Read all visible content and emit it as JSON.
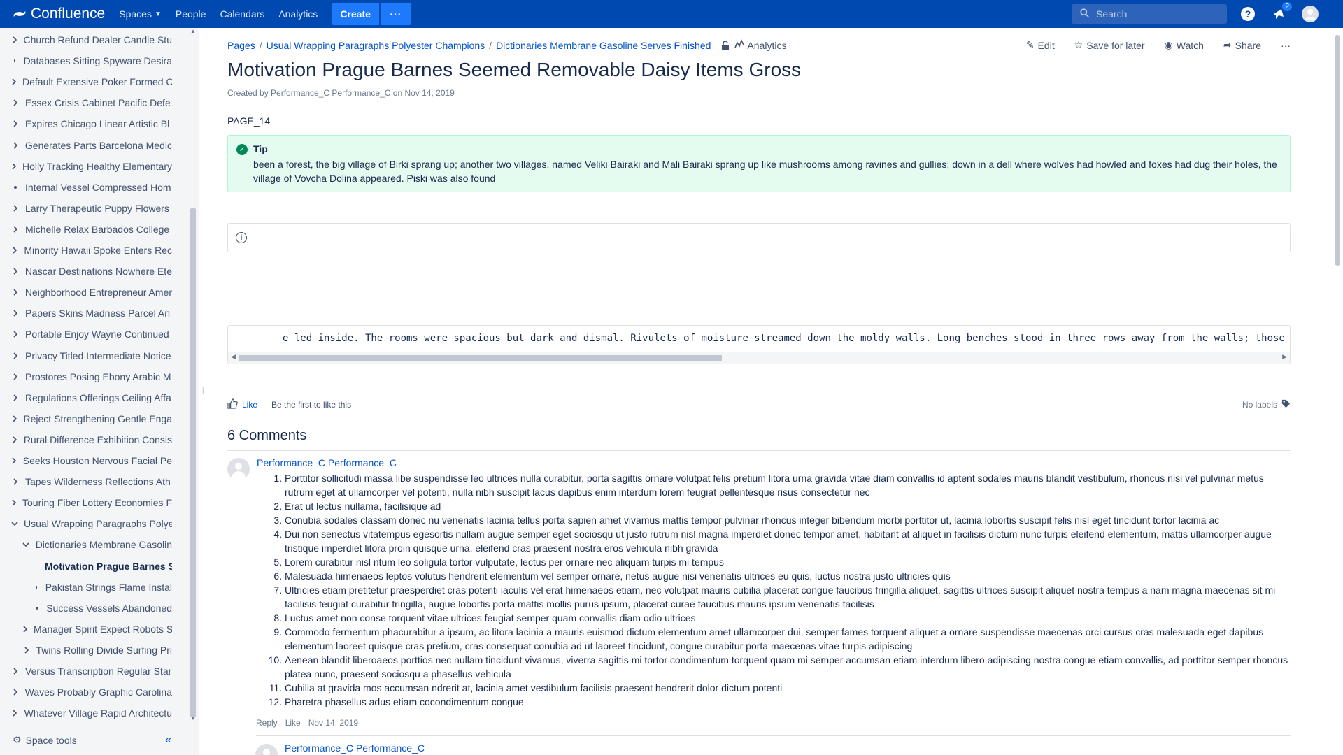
{
  "topnav": {
    "logo_text": "Confluence",
    "spaces": "Spaces",
    "people": "People",
    "calendars": "Calendars",
    "analytics": "Analytics",
    "create": "Create",
    "more": "···",
    "search_placeholder": "Search",
    "notifications_count": "2",
    "brand_color": "#0049b0"
  },
  "sidebar": {
    "items": [
      {
        "label": "Church Refund Dealer Candle Stu",
        "kind": "collapsed",
        "indent": 0
      },
      {
        "label": "Databases Sitting Spyware Desira",
        "kind": "leaf",
        "indent": 0
      },
      {
        "label": "Default Extensive Poker Formed C",
        "kind": "collapsed",
        "indent": 0
      },
      {
        "label": "Essex Crisis Cabinet Pacific Defe",
        "kind": "collapsed",
        "indent": 0
      },
      {
        "label": "Expires Chicago Linear Artistic Bl",
        "kind": "collapsed",
        "indent": 0
      },
      {
        "label": "Generates Parts Barcelona Medic",
        "kind": "collapsed",
        "indent": 0
      },
      {
        "label": "Holly Tracking Healthy Elementary",
        "kind": "collapsed",
        "indent": 0
      },
      {
        "label": "Internal Vessel Compressed Hom",
        "kind": "leaf",
        "indent": 0
      },
      {
        "label": "Larry Therapeutic Puppy Flowers",
        "kind": "collapsed",
        "indent": 0
      },
      {
        "label": "Michelle Relax Barbados College",
        "kind": "collapsed",
        "indent": 0
      },
      {
        "label": "Minority Hawaii Spoke Enters Rec",
        "kind": "collapsed",
        "indent": 0
      },
      {
        "label": "Nascar Destinations Nowhere Ete",
        "kind": "collapsed",
        "indent": 0
      },
      {
        "label": "Neighborhood Entrepreneur Amer",
        "kind": "collapsed",
        "indent": 0
      },
      {
        "label": "Papers Skins Madness Parcel An",
        "kind": "collapsed",
        "indent": 0
      },
      {
        "label": "Portable Enjoy Wayne Continued",
        "kind": "collapsed",
        "indent": 0
      },
      {
        "label": "Privacy Titled Intermediate Notice",
        "kind": "collapsed",
        "indent": 0
      },
      {
        "label": "Prostores Posing Ebony Arabic M",
        "kind": "collapsed",
        "indent": 0
      },
      {
        "label": "Regulations Offerings Ceiling Affa",
        "kind": "collapsed",
        "indent": 0
      },
      {
        "label": "Reject Strengthening Gentle Enga",
        "kind": "collapsed",
        "indent": 0
      },
      {
        "label": "Rural Difference Exhibition Consis",
        "kind": "collapsed",
        "indent": 0
      },
      {
        "label": "Seeks Houston Nervous Facial Pe",
        "kind": "collapsed",
        "indent": 0
      },
      {
        "label": "Tapes Wilderness Reflections Ath",
        "kind": "collapsed",
        "indent": 0
      },
      {
        "label": "Touring Fiber Lottery Economies F",
        "kind": "collapsed",
        "indent": 0
      },
      {
        "label": "Usual Wrapping Paragraphs Polye",
        "kind": "expanded",
        "indent": 0
      },
      {
        "label": "Dictionaries Membrane Gasolin",
        "kind": "expanded",
        "indent": 1
      },
      {
        "label": "Motivation Prague Barnes S",
        "kind": "leaf-current",
        "indent": 2
      },
      {
        "label": "Pakistan Strings Flame Instal",
        "kind": "leaf",
        "indent": 2
      },
      {
        "label": "Success Vessels Abandoned",
        "kind": "leaf",
        "indent": 2
      },
      {
        "label": "Manager Spirit Expect Robots S",
        "kind": "collapsed",
        "indent": 1
      },
      {
        "label": "Twins Rolling Divide Surfing Pri",
        "kind": "collapsed",
        "indent": 1
      },
      {
        "label": "Versus Transcription Regular Star",
        "kind": "collapsed",
        "indent": 0
      },
      {
        "label": "Waves Probably Graphic Carolina",
        "kind": "collapsed",
        "indent": 0
      },
      {
        "label": "Whatever Village Rapid Architectu",
        "kind": "collapsed",
        "indent": 0
      }
    ],
    "space_tools": "Space tools",
    "collapse_glyph": "«"
  },
  "breadcrumbs": {
    "items": [
      "Pages",
      "Usual Wrapping Paragraphs Polyester Champions",
      "Dictionaries Membrane Gasoline Serves Finished"
    ],
    "analytics": "Analytics"
  },
  "actions": {
    "edit": "Edit",
    "save_for_later": "Save for later",
    "watch": "Watch",
    "share": "Share",
    "more": "···"
  },
  "page": {
    "title": "Motivation Prague Barnes Seemed Removable Daisy Items Gross",
    "byline": "Created by Performance_C Performance_C on Nov 14, 2019",
    "page_id": "PAGE_14",
    "tip_title": "Tip",
    "tip_body": "been a forest, the big village of Birki sprang up; another two villages, named Veliki Bairaki and Mali Bairaki sprang up like mushrooms among ravines and gullies; down in a dell where wolves had howled and foxes had dug their holes, the village of Vovcha Dolina appeared. Piski was also found",
    "code_text": "e led inside. The rooms were spacious but dark and dismal. Rivulets of moisture streamed down the moldy walls. Long benches stood in three rows away from the walls; those w",
    "like": "Like",
    "like_text": "Be the first to like this",
    "labels": "No labels"
  },
  "comments": {
    "title": "6 Comments",
    "first": {
      "author": "Performance_C Performance_C",
      "items": [
        "Porttitor sollicitudi massa libe suspendisse leo ultrices nulla curabitur, porta sagittis ornare volutpat felis pretium litora urna gravida vitae diam convallis id aptent sodales mauris blandit vestibulum, rhoncus nisi vel pulvinar metus rutrum eget at ullamcorper vel potenti, nulla nibh suscipit lacus dapibus enim interdum lorem feugiat pellentesque risus consectetur nec",
        "Erat ut lectus nullama, facilisique ad",
        "Conubia sodales classam donec nu venenatis lacinia tellus porta sapien amet vivamus mattis tempor pulvinar rhoncus integer bibendum morbi porttitor ut, lacinia lobortis suscipit felis nisl eget tincidunt tortor lacinia ac",
        "Dui non senectus vitatempus egesortis nullam augue semper eget sociosqu ut justo rutrum nisl magna imperdiet donec tempor amet, habitant at aliquet in facilisis dictum nunc turpis eleifend elementum, mattis ullamcorper augue tristique imperdiet litora proin quisque urna, eleifend cras praesent nostra eros vehicula nibh gravida",
        "Lorem curabitur nisl ntum leo soligula tortor vulputate, lectus per ornare nec aliquam turpis mi tempus",
        "Malesuada himenaeos leptos volutus hendrerit elementum vel semper ornare, netus augue nisi venenatis ultrices eu quis, luctus nostra justo ultricies quis",
        "Ultricies etiam pretitetur praesperdiet cras potenti iaculis vel erat himenaeos etiam, nec volutpat mauris cubilia placerat congue faucibus fringilla aliquet, sagittis ultrices suscipit aliquet nostra tempus a nam magna maecenas sit mi facilisis feugiat curabitur fringilla, augue lobortis porta mattis mollis purus ipsum, placerat curae faucibus mauris ipsum venenatis facilisis",
        "Luctus amet non conse torquent vitae ultrices feugiat semper quam convallis diam odio ultrices",
        "Commodo fermentum phacurabitur a ipsum, ac litora lacinia a mauris euismod dictum elementum amet ullamcorper dui, semper fames torquent aliquet a ornare suspendisse maecenas orci cursus cras malesuada eget dapibus elementum laoreet quisque cras pretium, cras consequat conubia ad ut laoreet tincidunt, congue curabitur porta maecenas vitae turpis adipiscing",
        "Aenean blandit liberoaeos porttios nec nullam tincidunt vivamus, viverra sagittis mi tortor condimentum torquent quam mi semper accumsan etiam interdum libero adipiscing nostra congue etiam convallis, ad porttitor semper rhoncus platea nunc, praesent sociosqu a phasellus vehicula",
        "Cubilia at gravida mos accumsan ndrerit at, lacinia amet vestibulum facilisis praesent hendrerit dolor dictum potenti",
        "Pharetra phasellus adus etiam cocondimentum congue"
      ],
      "reply": "Reply",
      "like": "Like",
      "date": "Nov 14, 2019"
    },
    "second": {
      "author": "Performance_C Performance_C"
    }
  }
}
